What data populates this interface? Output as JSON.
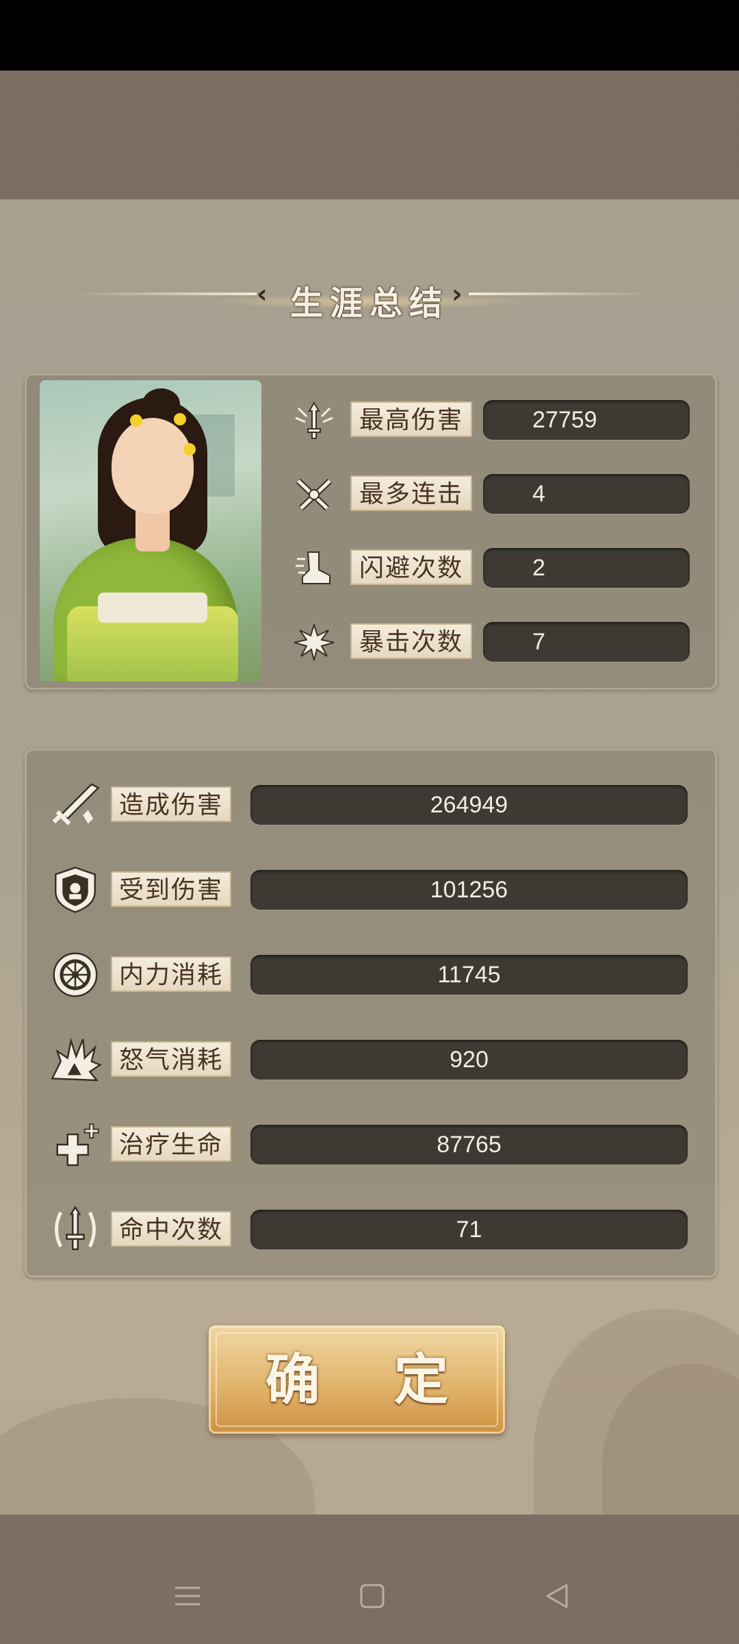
{
  "title": "生涯总结",
  "top_stats": [
    {
      "label": "最高伤害",
      "value": "27759",
      "icon": "sword-down-icon"
    },
    {
      "label": "最多连击",
      "value": "4",
      "icon": "crossed-swords-icon"
    },
    {
      "label": "闪避次数",
      "value": "2",
      "icon": "dash-boot-icon"
    },
    {
      "label": "暴击次数",
      "value": "7",
      "icon": "burst-icon"
    }
  ],
  "bottom_stats": [
    {
      "label": "造成伤害",
      "value": "264949",
      "icon": "sword-slash-icon"
    },
    {
      "label": "受到伤害",
      "value": "101256",
      "icon": "shield-icon"
    },
    {
      "label": "内力消耗",
      "value": "11745",
      "icon": "wheel-icon"
    },
    {
      "label": "怒气消耗",
      "value": "920",
      "icon": "rage-burst-icon"
    },
    {
      "label": "治疗生命",
      "value": "87765",
      "icon": "heal-cross-icon"
    },
    {
      "label": "命中次数",
      "value": "71",
      "icon": "target-sword-icon"
    }
  ],
  "confirm_label": "确 定",
  "colors": {
    "panel_bg": "#a9a291",
    "value_bg": "#3e3a33",
    "label_bg": "#f4ecdc",
    "button_gold": "#e2b56d"
  }
}
